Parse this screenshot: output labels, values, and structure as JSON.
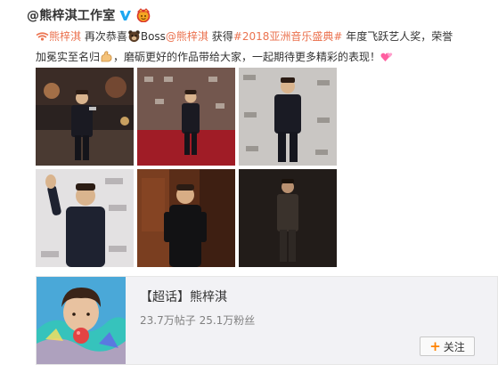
{
  "post": {
    "author": "@熊梓淇工作室",
    "verified_icon": "verified-v-icon",
    "badge_icon": "crown-badge-icon",
    "text": {
      "mention1": "熊梓淇",
      "t1": " 再次恭喜",
      "boss": "Boss",
      "mention2": "@熊梓淇",
      "t2": " 获得",
      "hashtag": "#2018亚洲音乐盛典#",
      "t3": " 年度飞跃艺人奖，荣誉加冕实至名归",
      "t4": "，磨砺更好的作品带给大家，一起期待更多精彩的表现！"
    },
    "photos": [
      {
        "name": "photo-1",
        "bg": "#2a2220"
      },
      {
        "name": "photo-2",
        "bg": "#7d1a22"
      },
      {
        "name": "photo-3",
        "bg": "#c9c6c3"
      },
      {
        "name": "photo-4",
        "bg": "#e3e1e2"
      },
      {
        "name": "photo-5",
        "bg": "#5a2d18"
      },
      {
        "name": "photo-6",
        "bg": "#1a1614"
      }
    ]
  },
  "card": {
    "title": "【超话】熊梓淇",
    "posts": "23.7万帖子",
    "fans": "25.1万粉丝",
    "follow_label": "关注",
    "follow_icon": "plus-icon"
  },
  "colors": {
    "link": "#eb7350",
    "verified": "#1ea7f0",
    "follow_plus": "#ff8200"
  }
}
